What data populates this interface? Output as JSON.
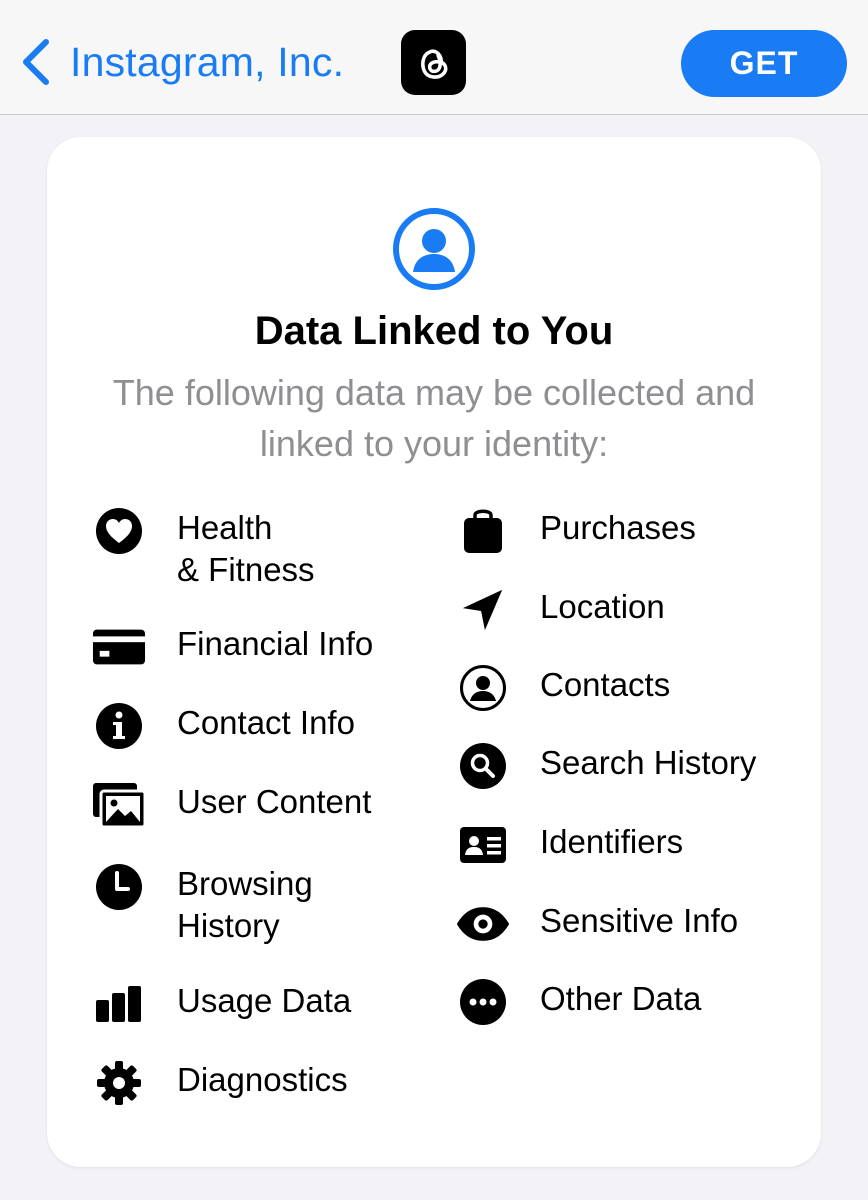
{
  "nav": {
    "back_label": "Instagram, Inc.",
    "app_icon": "threads-app-icon",
    "get_label": "GET",
    "accent_color": "#1a7cf5"
  },
  "card": {
    "icon": "person-circle-icon",
    "title": "Data Linked to You",
    "subtitle": "The following data may be collected and linked to your identity:",
    "left_items": [
      {
        "label": "Health\n& Fitness",
        "icon": "heart-circle-icon"
      },
      {
        "label": "Financial Info",
        "icon": "credit-card-icon"
      },
      {
        "label": "Contact Info",
        "icon": "info-circle-icon"
      },
      {
        "label": "User Content",
        "icon": "photos-icon"
      },
      {
        "label": "Browsing\nHistory",
        "icon": "clock-icon"
      },
      {
        "label": "Usage Data",
        "icon": "bar-chart-icon"
      },
      {
        "label": "Diagnostics",
        "icon": "gear-icon"
      }
    ],
    "right_items": [
      {
        "label": "Purchases",
        "icon": "shopping-bag-icon"
      },
      {
        "label": "Location",
        "icon": "location-arrow-icon"
      },
      {
        "label": "Contacts",
        "icon": "person-circle-outline-icon"
      },
      {
        "label": "Search History",
        "icon": "magnifier-circle-icon"
      },
      {
        "label": "Identifiers",
        "icon": "id-card-icon"
      },
      {
        "label": "Sensitive Info",
        "icon": "eye-icon"
      },
      {
        "label": "Other Data",
        "icon": "ellipsis-circle-icon"
      }
    ]
  }
}
